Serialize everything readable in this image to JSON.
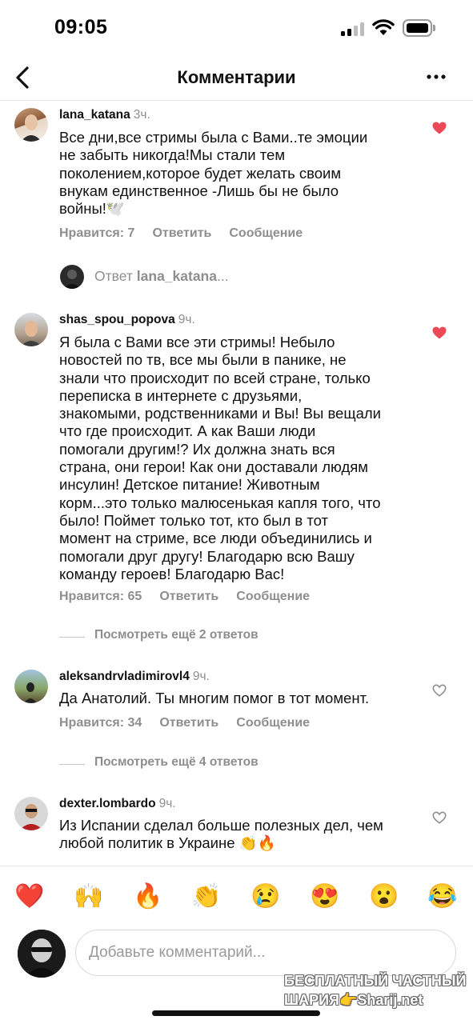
{
  "status_bar": {
    "time": "09:05"
  },
  "header": {
    "title": "Комментарии"
  },
  "comments": [
    {
      "username": "lana_katana",
      "ago": "3ч.",
      "text": "Все дни,все стримы была с Вами..те эмоции\nне забыть никогда!Мы стали тем\nпоколением,которое будет желать своим\nвнукам единственное -Лишь бы не было\nвойны!🕊️",
      "likes": "Нравится: 7",
      "reply": "Ответить",
      "message": "Сообщение",
      "liked": true
    },
    {
      "username": "shas_spou_popova",
      "ago": "9ч.",
      "text": "Я была с Вами все эти стримы! Небыло\nновостей по тв, все мы были в панике, не\nзнали что происходит по всей стране, только\nпереписка в интернете с друзьями,\nзнакомыми, родственниками и Вы! Вы вещали\nчто где происходит. А как Ваши люди\nпомогали другим!? Их должна знать вся\nстрана, они герои! Как они доставали людям\nинсулин! Детское питание! Животным\nкорм...это только малюсенькая капля того, что\nбыло! Поймет только тот, кто  был в тот\nмомент на стриме, все люди объединились и\nпомогали друг другу! Благодарю всю Вашу\nкоманду героев! Благодарю Вас!",
      "likes": "Нравится: 65",
      "reply": "Ответить",
      "message": "Сообщение",
      "liked": true
    },
    {
      "username": "aleksandrvladimirovl4",
      "ago": "9ч.",
      "text": "Да Анатолий. Ты многим помог в тот момент.",
      "likes": "Нравится: 34",
      "reply": "Ответить",
      "message": "Сообщение",
      "liked": false
    },
    {
      "username": "dexter.lombardo",
      "ago": "9ч.",
      "text": "Из Испании сделал больше полезных дел, чем\nлюбой политик в Украине 👏🔥",
      "liked": false
    }
  ],
  "reply_preview": {
    "prefix": "Ответ",
    "username": "lana_katana",
    "suffix": "..."
  },
  "more_replies": [
    "Посмотреть ещё 2 ответов",
    "Посмотреть ещё 4 ответов"
  ],
  "emoji_bar": [
    "❤️",
    "🙌",
    "🔥",
    "👏",
    "😢",
    "😍",
    "😮",
    "😂"
  ],
  "composer": {
    "placeholder": "Добавьте комментарий..."
  },
  "watermark": {
    "line1": "БЕСПЛАТНЫЙ ЧАСТНЫЙ",
    "line2": "ШАРИЯ👉Sharij.net"
  },
  "colors": {
    "heart_liked": "#ed4956",
    "secondary_text": "#8e8e8e"
  }
}
